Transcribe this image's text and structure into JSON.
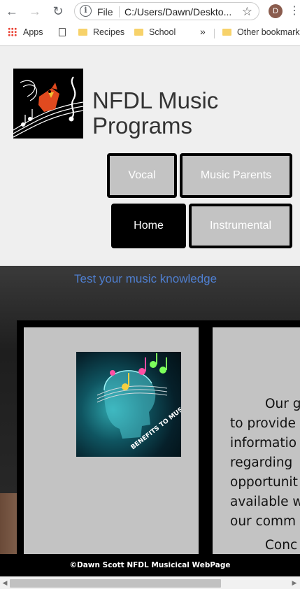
{
  "browser": {
    "file_label": "File",
    "url": "C:/Users/Dawn/Deskto...",
    "avatar_letter": "D",
    "bookmarks": {
      "apps": "Apps",
      "recipes": "Recipes",
      "school": "School",
      "overflow": "»",
      "other": "Other bookmarks"
    }
  },
  "site": {
    "title": "NFDL Music Programs",
    "nav": {
      "vocal": "Vocal",
      "music_parents": "Music Parents",
      "home": "Home",
      "instrumental": "Instrumental"
    },
    "quiz_link": "Test your music knowledge",
    "brain_caption": "BENEFITS TO MUSIC",
    "intro_lines": [
      "Our g",
      "to provide",
      "informatio",
      "regarding",
      "opportunit",
      "available w",
      "our comm",
      "Conc"
    ],
    "footer": "©Dawn Scott NFDL Musicical WebPage"
  },
  "colors": {
    "link": "#4f7fd0",
    "nav_light": "#c3c3c3",
    "nav_dark": "#000000",
    "panel": "#c3c3c3"
  }
}
